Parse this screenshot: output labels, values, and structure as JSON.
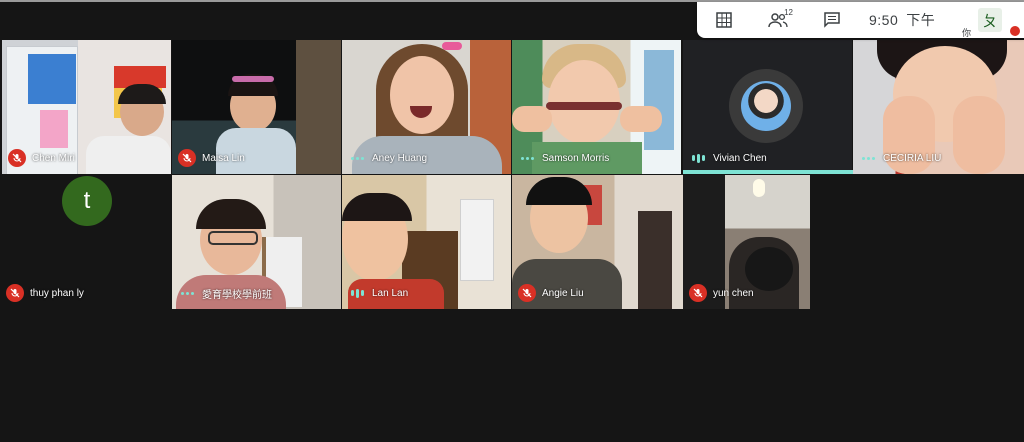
{
  "toolbar": {
    "grid_icon": "grid-view-icon",
    "people_icon": "people-icon",
    "participant_count": "12",
    "chat_icon": "chat-icon",
    "time": "9:50",
    "ampm": "下午",
    "ime_char_small": "你",
    "ime_char": "ㄆ"
  },
  "colors": {
    "mic_off": "#d93025",
    "speaking": "#7ee3d4",
    "avatar_t": "#33691e"
  },
  "participants": [
    {
      "name": "Chen Miri",
      "status": "muted"
    },
    {
      "name": "Maisa Lin",
      "status": "muted"
    },
    {
      "name": "Aney Huang",
      "status": "idle"
    },
    {
      "name": "Samson Morris",
      "status": "idle"
    },
    {
      "name": "Vivian Chen",
      "status": "speaking"
    },
    {
      "name": "CECIRIA LIU",
      "status": "idle"
    },
    {
      "name": "thuy phan ly",
      "status": "muted",
      "avatar_letter": "t"
    },
    {
      "name": "愛育學校學前班",
      "status": "idle"
    },
    {
      "name": "Lan Lan",
      "status": "speaking"
    },
    {
      "name": "Angie Liu",
      "status": "muted"
    },
    {
      "name": "yun chen",
      "status": "muted"
    }
  ]
}
